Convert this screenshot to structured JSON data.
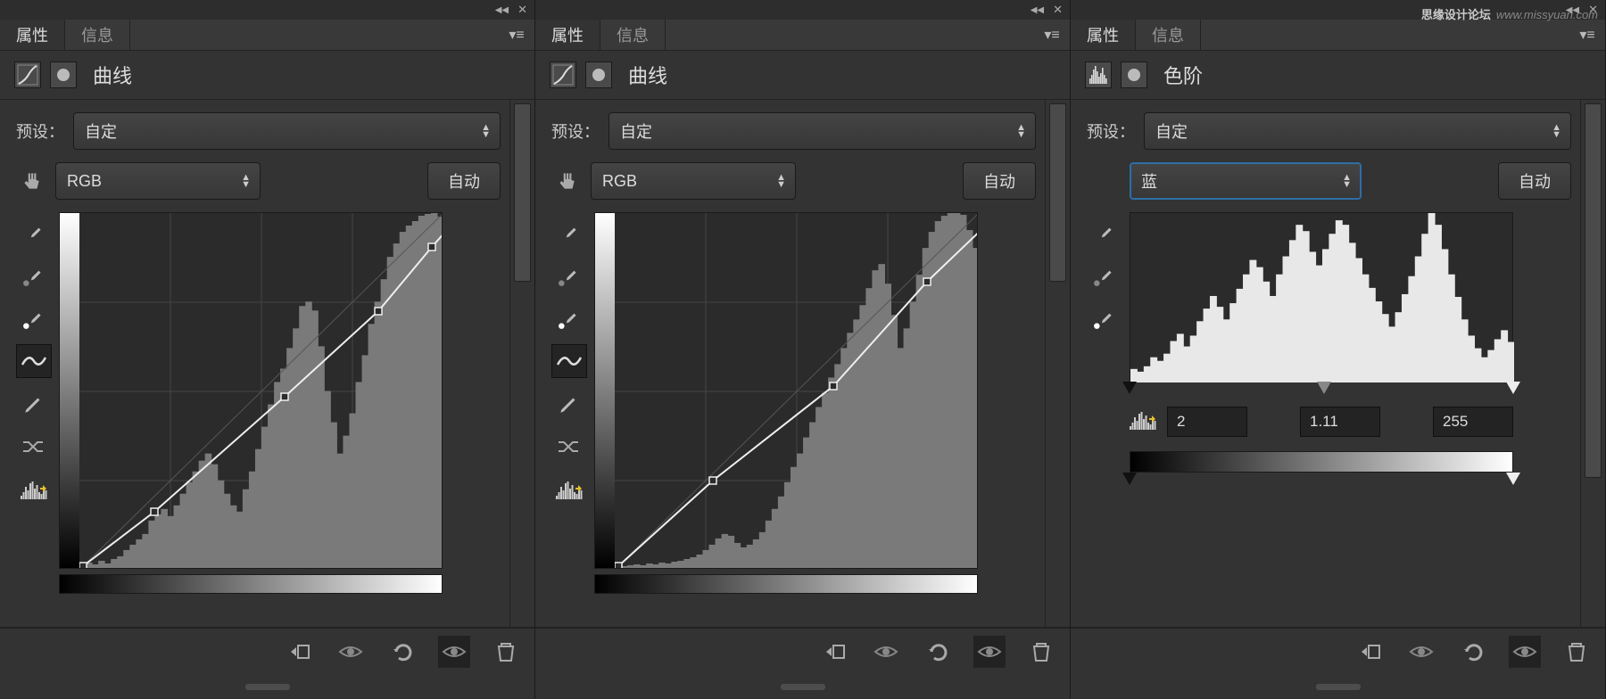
{
  "watermark": {
    "main": "思缘设计论坛",
    "url": "www.missyuan.com"
  },
  "common": {
    "tabs": {
      "properties": "属性",
      "info": "信息"
    },
    "presetLabel": "预设：",
    "presetValue": "自定",
    "auto": "自动"
  },
  "panels": [
    {
      "title": "曲线",
      "type": "curves",
      "channel": "RGB",
      "curvePoints": [
        [
          4,
          396
        ],
        [
          84,
          335
        ],
        [
          230,
          206
        ],
        [
          335,
          110
        ],
        [
          395,
          38
        ],
        [
          420,
          10
        ]
      ],
      "hist": [
        5,
        8,
        6,
        10,
        7,
        12,
        15,
        22,
        28,
        34,
        40,
        55,
        62,
        68,
        60,
        72,
        85,
        98,
        110,
        122,
        130,
        118,
        100,
        85,
        72,
        65,
        90,
        110,
        135,
        160,
        185,
        210,
        225,
        248,
        270,
        295,
        300,
        290,
        250,
        200,
        165,
        130,
        150,
        175,
        210,
        240,
        275,
        300,
        325,
        350,
        365,
        378,
        385,
        390,
        396,
        398,
        399,
        395
      ]
    },
    {
      "title": "曲线",
      "type": "curves",
      "channel": "RGB",
      "curvePoints": [
        [
          4,
          396
        ],
        [
          110,
          300
        ],
        [
          245,
          194
        ],
        [
          350,
          77
        ],
        [
          420,
          10
        ]
      ],
      "hist": [
        3,
        4,
        5,
        6,
        5,
        7,
        6,
        8,
        7,
        9,
        10,
        12,
        14,
        17,
        22,
        28,
        35,
        40,
        38,
        30,
        25,
        28,
        34,
        42,
        55,
        68,
        82,
        98,
        115,
        130,
        148,
        165,
        182,
        198,
        215,
        230,
        248,
        265,
        280,
        296,
        315,
        335,
        342,
        320,
        285,
        248,
        270,
        300,
        330,
        360,
        378,
        390,
        396,
        399,
        399,
        397,
        380,
        360
      ]
    },
    {
      "title": "色阶",
      "type": "levels",
      "channel": "蓝",
      "inputs": {
        "black": "2",
        "mid": "1.11",
        "white": "255"
      },
      "hist": [
        15,
        12,
        18,
        28,
        24,
        32,
        46,
        54,
        40,
        52,
        68,
        82,
        96,
        84,
        70,
        88,
        104,
        120,
        136,
        128,
        112,
        96,
        120,
        140,
        158,
        175,
        168,
        145,
        130,
        148,
        165,
        180,
        175,
        155,
        138,
        120,
        105,
        90,
        76,
        62,
        78,
        98,
        118,
        140,
        165,
        188,
        175,
        148,
        120,
        95,
        70,
        52,
        38,
        28,
        36,
        48,
        58,
        45
      ]
    }
  ],
  "footerIcons": [
    "clip-icon",
    "visibility-icon",
    "reset-icon",
    "view-prev-icon",
    "trash-icon"
  ]
}
